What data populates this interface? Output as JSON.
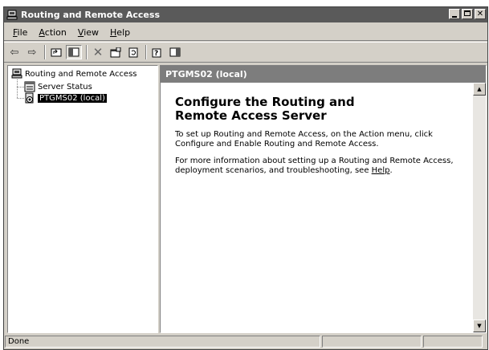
{
  "window": {
    "title": "Routing and Remote Access"
  },
  "menu": {
    "file": {
      "pre": "",
      "key": "F",
      "post": "ile"
    },
    "action": {
      "pre": "",
      "key": "A",
      "post": "ction"
    },
    "view": {
      "pre": "",
      "key": "V",
      "post": "iew"
    },
    "help": {
      "pre": "",
      "key": "H",
      "post": "elp"
    }
  },
  "tree": {
    "root": "Routing and Remote Access",
    "items": [
      {
        "label": "Server Status"
      },
      {
        "label": "PTGMS02 (local)",
        "selected": true
      }
    ]
  },
  "detail": {
    "header": "PTGMS02 (local)",
    "heading": "Configure the Routing and Remote Access Server",
    "para1": "To set up Routing and Remote Access, on the Action menu, click Configure and Enable Routing and Remote Access.",
    "para2_prefix": "For more information about setting up a Routing and Remote Access, deployment scenarios, and troubleshooting, see ",
    "para2_link": "Help",
    "para2_suffix": "."
  },
  "status": {
    "text": "Done"
  }
}
